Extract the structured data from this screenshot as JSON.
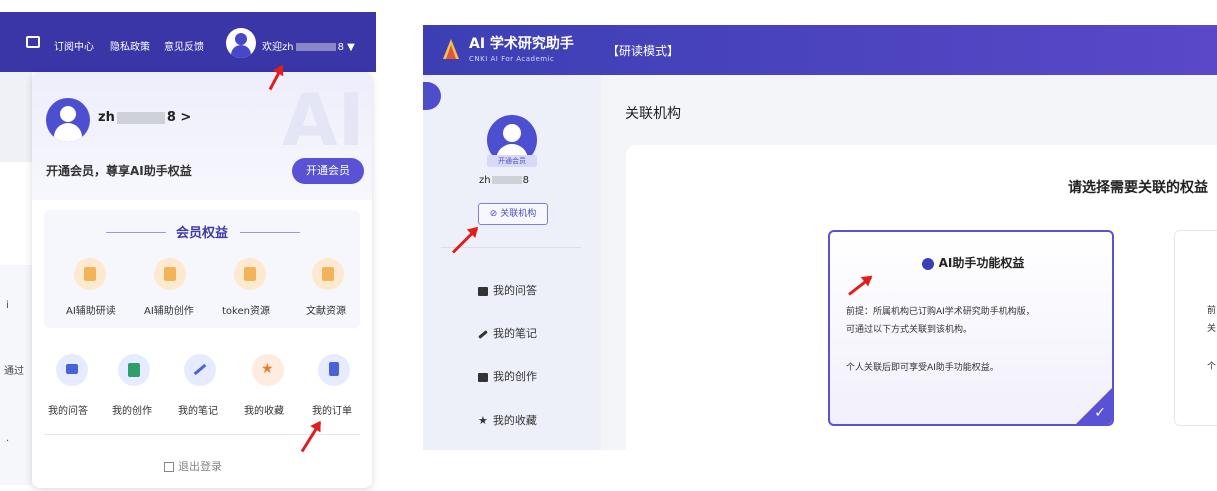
{
  "left_panel": {
    "topbar": {
      "subscription": "订阅中心",
      "privacy": "隐私政策",
      "feedback": "意见反馈",
      "welcome": "欢迎zh",
      "welcome_suffix": "8 ▼"
    },
    "dropdown": {
      "username_prefix": "zh",
      "username_suffix": "8 >",
      "watermark": "AI",
      "promo": "开通会员，尊享AI助手权益",
      "open_button": "开通会员",
      "benefits_title": "会员权益",
      "benefits": [
        {
          "label": "AI辅助研读",
          "icon": "book-icon"
        },
        {
          "label": "AI辅助创作",
          "icon": "edit-doc-icon"
        },
        {
          "label": "token资源",
          "icon": "token-icon"
        },
        {
          "label": "文献资源",
          "icon": "library-icon"
        }
      ],
      "actions": [
        {
          "label": "我的问答",
          "icon": "chat-icon"
        },
        {
          "label": "我的创作",
          "icon": "write-icon"
        },
        {
          "label": "我的笔记",
          "icon": "pen-icon"
        },
        {
          "label": "我的收藏",
          "icon": "star-icon"
        },
        {
          "label": "我的订单",
          "icon": "clipboard-icon"
        }
      ],
      "logout": "退出登录"
    },
    "background_text": [
      "i",
      "通过",
      "·"
    ]
  },
  "right_panel": {
    "app_title": "AI 学术研究助手",
    "app_subtitle": "CNKI AI For Academic",
    "mode": "【研读模式】",
    "sidebar": {
      "badge": "开通会员",
      "username_prefix": "zh",
      "username_suffix": "8",
      "link_button": "关联机构",
      "nav": [
        "我的问答",
        "我的笔记",
        "我的创作",
        "我的收藏"
      ]
    },
    "main": {
      "title": "关联机构",
      "select_prompt": "请选择需要关联的权益",
      "option1": {
        "title": "AI助手功能权益",
        "line1": "前提：所属机构已订购AI学术研究助手机构版，",
        "line2": "可通过以下方式关联到该机构。",
        "line3": "个人关联后即可享受AI助手功能权益。"
      },
      "option2_lines": [
        "前",
        "关",
        "个"
      ]
    }
  },
  "colors": {
    "brand": "#3a36a8",
    "accent": "#5a52d5",
    "arrow": "#e11d1d"
  }
}
